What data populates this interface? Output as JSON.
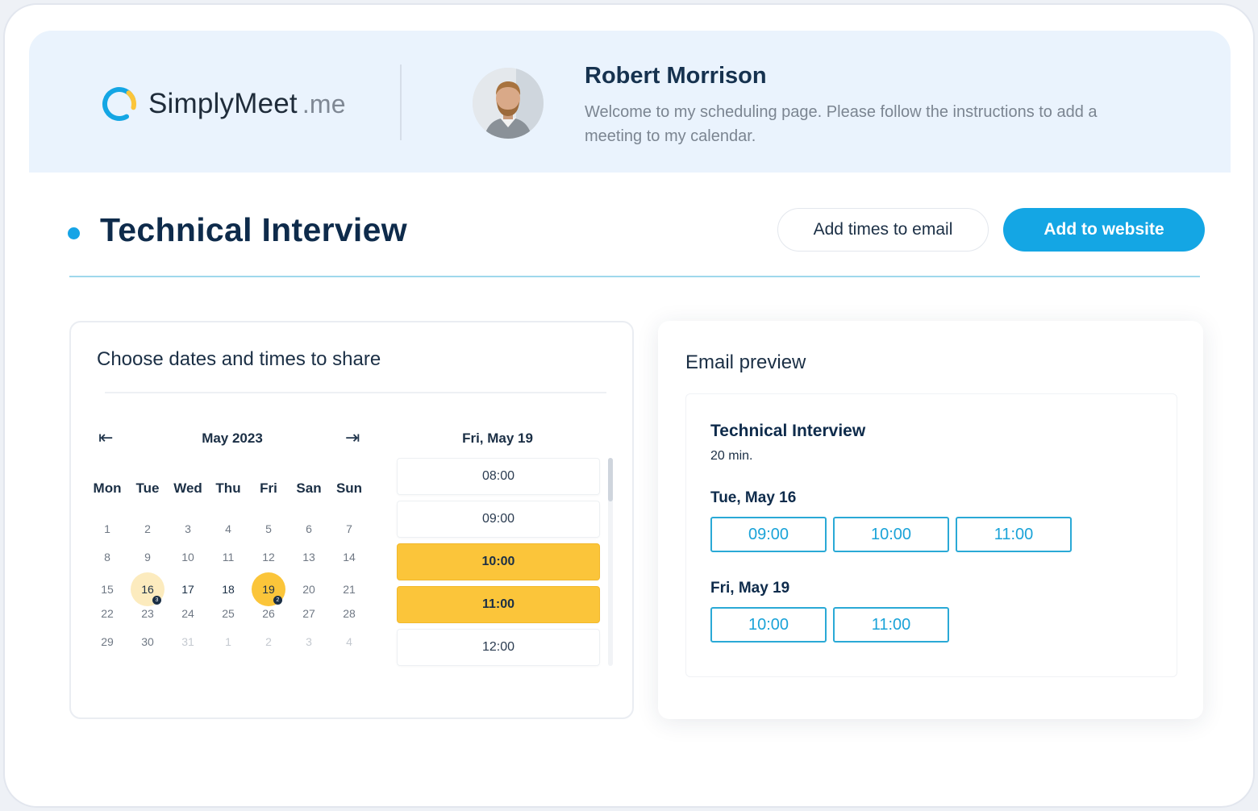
{
  "brand": {
    "name_main": "SimplyMeet",
    "name_suffix": ".me",
    "colors": {
      "accent": "#14a6e4",
      "highlight": "#fbc53a",
      "highlight_soft": "#fcebbe",
      "header_bg": "#eaf3fd"
    }
  },
  "host": {
    "name": "Robert Morrison",
    "welcome": "Welcome to my scheduling page. Please follow the instructions to add a meeting to my calendar."
  },
  "page": {
    "title": "Technical Interview"
  },
  "actions": {
    "add_times_email": "Add times to email",
    "add_to_website": "Add to website"
  },
  "chooser": {
    "title": "Choose dates and times to share",
    "prev_icon": "arrow-left-icon",
    "next_icon": "arrow-right-icon",
    "prev_glyph": "⇤",
    "next_glyph": "⇥",
    "month": "May 2023",
    "weekdays": [
      "Mon",
      "Tue",
      "Wed",
      "Thu",
      "Fri",
      "San",
      "Sun"
    ],
    "weeks": [
      [
        {
          "d": "1"
        },
        {
          "d": "2"
        },
        {
          "d": "3"
        },
        {
          "d": "4"
        },
        {
          "d": "5"
        },
        {
          "d": "6"
        },
        {
          "d": "7"
        }
      ],
      [
        {
          "d": "8"
        },
        {
          "d": "9"
        },
        {
          "d": "10"
        },
        {
          "d": "11"
        },
        {
          "d": "12"
        },
        {
          "d": "13"
        },
        {
          "d": "14"
        }
      ],
      [
        {
          "d": "15"
        },
        {
          "d": "16",
          "sel": "soft",
          "badge": "3"
        },
        {
          "d": "17",
          "dark": true
        },
        {
          "d": "18",
          "dark": true
        },
        {
          "d": "19",
          "sel": "strong",
          "badge": "2"
        },
        {
          "d": "20"
        },
        {
          "d": "21"
        }
      ],
      [
        {
          "d": "22"
        },
        {
          "d": "23"
        },
        {
          "d": "24"
        },
        {
          "d": "25"
        },
        {
          "d": "26"
        },
        {
          "d": "27"
        },
        {
          "d": "28"
        }
      ],
      [
        {
          "d": "29"
        },
        {
          "d": "30"
        },
        {
          "d": "31",
          "muted": true
        },
        {
          "d": "1",
          "muted": true
        },
        {
          "d": "2",
          "muted": true
        },
        {
          "d": "3",
          "muted": true
        },
        {
          "d": "4",
          "muted": true
        }
      ]
    ],
    "selected_day_label": "Fri, May 19",
    "slots": [
      {
        "time": "08:00",
        "active": false
      },
      {
        "time": "09:00",
        "active": false
      },
      {
        "time": "10:00",
        "active": true
      },
      {
        "time": "11:00",
        "active": true
      },
      {
        "time": "12:00",
        "active": false
      }
    ]
  },
  "email_preview": {
    "title": "Email preview",
    "meeting_title": "Technical Interview",
    "duration": "20 min.",
    "groups": [
      {
        "date": "Tue, May 16",
        "times": [
          "09:00",
          "10:00",
          "11:00"
        ]
      },
      {
        "date": "Fri, May 19",
        "times": [
          "10:00",
          "11:00"
        ]
      }
    ]
  }
}
